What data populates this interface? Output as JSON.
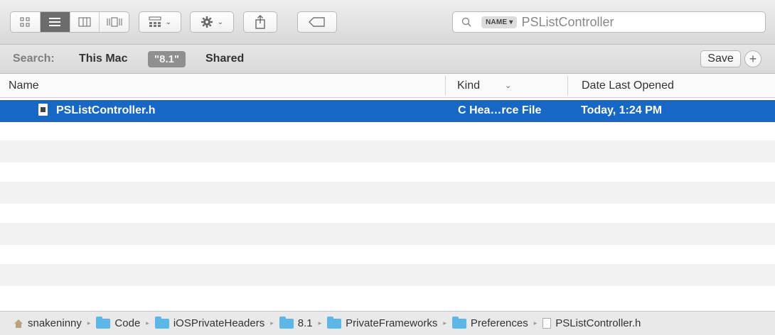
{
  "toolbar": {
    "view_icons": [
      "icon-view-icon",
      "list-view-icon",
      "column-view-icon",
      "coverflow-view-icon"
    ],
    "arrange_icon": "grid-arrange-icon",
    "action_icon": "gear-icon",
    "share_icon": "share-icon",
    "tag_icon": "tag-icon"
  },
  "search": {
    "token": "NAME",
    "token_chevron": "▾",
    "query": "PSListController"
  },
  "scope": {
    "label": "Search:",
    "options": [
      "This Mac",
      "\"8.1\"",
      "Shared"
    ],
    "save": "Save",
    "add": "+"
  },
  "columns": {
    "name": "Name",
    "kind": "Kind",
    "date": "Date Last Opened"
  },
  "files": [
    {
      "name": "PSListController.h",
      "kind": "C Hea…rce File",
      "date": "Today, 1:24 PM",
      "selected": true
    }
  ],
  "path": {
    "items": [
      "snakeninny",
      "Code",
      "iOSPrivateHeaders",
      "8.1",
      "PrivateFrameworks",
      "Preferences",
      "PSListController.h"
    ]
  },
  "colors": {
    "selection": "#1767c7",
    "folder": "#5cb7e8"
  }
}
